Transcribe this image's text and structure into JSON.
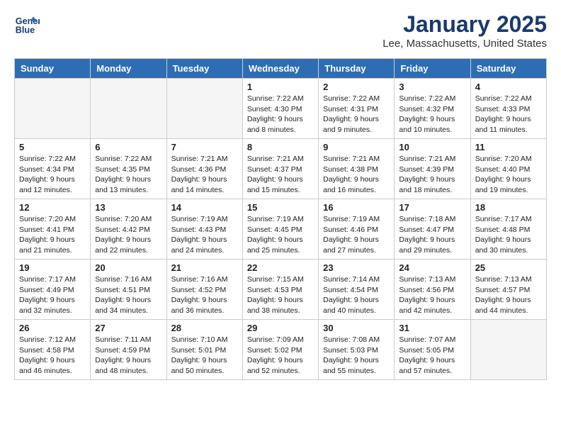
{
  "header": {
    "logo_line1": "General",
    "logo_line2": "Blue",
    "month_title": "January 2025",
    "location": "Lee, Massachusetts, United States"
  },
  "weekdays": [
    "Sunday",
    "Monday",
    "Tuesday",
    "Wednesday",
    "Thursday",
    "Friday",
    "Saturday"
  ],
  "weeks": [
    [
      {
        "day": "",
        "detail": ""
      },
      {
        "day": "",
        "detail": ""
      },
      {
        "day": "",
        "detail": ""
      },
      {
        "day": "1",
        "detail": "Sunrise: 7:22 AM\nSunset: 4:30 PM\nDaylight: 9 hours\nand 8 minutes."
      },
      {
        "day": "2",
        "detail": "Sunrise: 7:22 AM\nSunset: 4:31 PM\nDaylight: 9 hours\nand 9 minutes."
      },
      {
        "day": "3",
        "detail": "Sunrise: 7:22 AM\nSunset: 4:32 PM\nDaylight: 9 hours\nand 10 minutes."
      },
      {
        "day": "4",
        "detail": "Sunrise: 7:22 AM\nSunset: 4:33 PM\nDaylight: 9 hours\nand 11 minutes."
      }
    ],
    [
      {
        "day": "5",
        "detail": "Sunrise: 7:22 AM\nSunset: 4:34 PM\nDaylight: 9 hours\nand 12 minutes."
      },
      {
        "day": "6",
        "detail": "Sunrise: 7:22 AM\nSunset: 4:35 PM\nDaylight: 9 hours\nand 13 minutes."
      },
      {
        "day": "7",
        "detail": "Sunrise: 7:21 AM\nSunset: 4:36 PM\nDaylight: 9 hours\nand 14 minutes."
      },
      {
        "day": "8",
        "detail": "Sunrise: 7:21 AM\nSunset: 4:37 PM\nDaylight: 9 hours\nand 15 minutes."
      },
      {
        "day": "9",
        "detail": "Sunrise: 7:21 AM\nSunset: 4:38 PM\nDaylight: 9 hours\nand 16 minutes."
      },
      {
        "day": "10",
        "detail": "Sunrise: 7:21 AM\nSunset: 4:39 PM\nDaylight: 9 hours\nand 18 minutes."
      },
      {
        "day": "11",
        "detail": "Sunrise: 7:20 AM\nSunset: 4:40 PM\nDaylight: 9 hours\nand 19 minutes."
      }
    ],
    [
      {
        "day": "12",
        "detail": "Sunrise: 7:20 AM\nSunset: 4:41 PM\nDaylight: 9 hours\nand 21 minutes."
      },
      {
        "day": "13",
        "detail": "Sunrise: 7:20 AM\nSunset: 4:42 PM\nDaylight: 9 hours\nand 22 minutes."
      },
      {
        "day": "14",
        "detail": "Sunrise: 7:19 AM\nSunset: 4:43 PM\nDaylight: 9 hours\nand 24 minutes."
      },
      {
        "day": "15",
        "detail": "Sunrise: 7:19 AM\nSunset: 4:45 PM\nDaylight: 9 hours\nand 25 minutes."
      },
      {
        "day": "16",
        "detail": "Sunrise: 7:19 AM\nSunset: 4:46 PM\nDaylight: 9 hours\nand 27 minutes."
      },
      {
        "day": "17",
        "detail": "Sunrise: 7:18 AM\nSunset: 4:47 PM\nDaylight: 9 hours\nand 29 minutes."
      },
      {
        "day": "18",
        "detail": "Sunrise: 7:17 AM\nSunset: 4:48 PM\nDaylight: 9 hours\nand 30 minutes."
      }
    ],
    [
      {
        "day": "19",
        "detail": "Sunrise: 7:17 AM\nSunset: 4:49 PM\nDaylight: 9 hours\nand 32 minutes."
      },
      {
        "day": "20",
        "detail": "Sunrise: 7:16 AM\nSunset: 4:51 PM\nDaylight: 9 hours\nand 34 minutes."
      },
      {
        "day": "21",
        "detail": "Sunrise: 7:16 AM\nSunset: 4:52 PM\nDaylight: 9 hours\nand 36 minutes."
      },
      {
        "day": "22",
        "detail": "Sunrise: 7:15 AM\nSunset: 4:53 PM\nDaylight: 9 hours\nand 38 minutes."
      },
      {
        "day": "23",
        "detail": "Sunrise: 7:14 AM\nSunset: 4:54 PM\nDaylight: 9 hours\nand 40 minutes."
      },
      {
        "day": "24",
        "detail": "Sunrise: 7:13 AM\nSunset: 4:56 PM\nDaylight: 9 hours\nand 42 minutes."
      },
      {
        "day": "25",
        "detail": "Sunrise: 7:13 AM\nSunset: 4:57 PM\nDaylight: 9 hours\nand 44 minutes."
      }
    ],
    [
      {
        "day": "26",
        "detail": "Sunrise: 7:12 AM\nSunset: 4:58 PM\nDaylight: 9 hours\nand 46 minutes."
      },
      {
        "day": "27",
        "detail": "Sunrise: 7:11 AM\nSunset: 4:59 PM\nDaylight: 9 hours\nand 48 minutes."
      },
      {
        "day": "28",
        "detail": "Sunrise: 7:10 AM\nSunset: 5:01 PM\nDaylight: 9 hours\nand 50 minutes."
      },
      {
        "day": "29",
        "detail": "Sunrise: 7:09 AM\nSunset: 5:02 PM\nDaylight: 9 hours\nand 52 minutes."
      },
      {
        "day": "30",
        "detail": "Sunrise: 7:08 AM\nSunset: 5:03 PM\nDaylight: 9 hours\nand 55 minutes."
      },
      {
        "day": "31",
        "detail": "Sunrise: 7:07 AM\nSunset: 5:05 PM\nDaylight: 9 hours\nand 57 minutes."
      },
      {
        "day": "",
        "detail": ""
      }
    ]
  ]
}
